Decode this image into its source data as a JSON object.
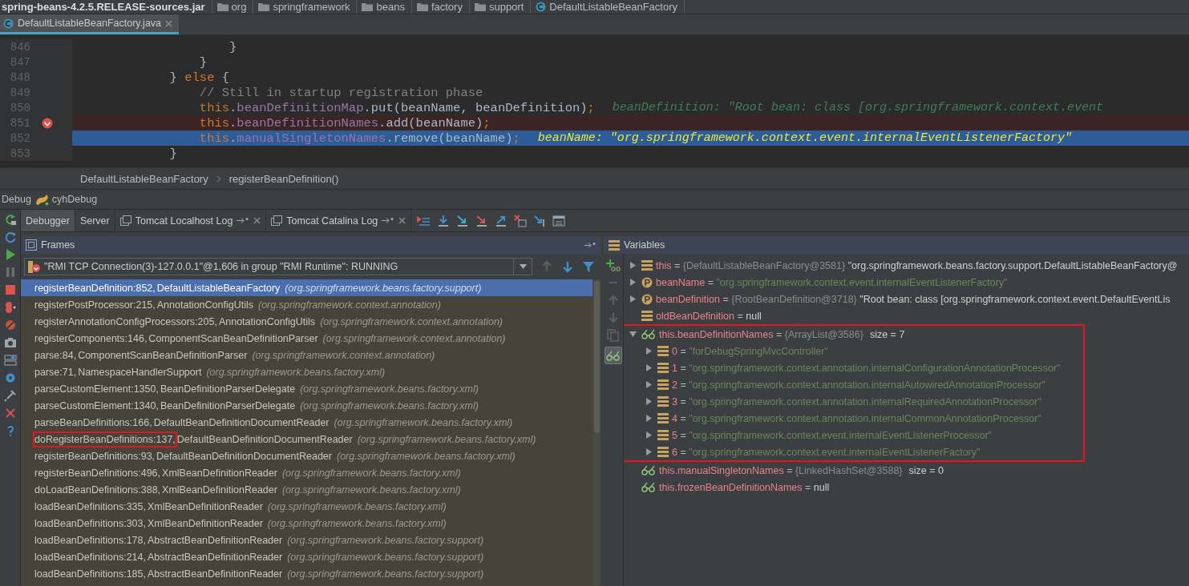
{
  "nav_bar": {
    "items": [
      {
        "label": "spring-beans-4.2.5.RELEASE-sources.jar",
        "kind": "jar"
      },
      {
        "label": "org",
        "kind": "folder"
      },
      {
        "label": "springframework",
        "kind": "folder"
      },
      {
        "label": "beans",
        "kind": "folder"
      },
      {
        "label": "factory",
        "kind": "folder"
      },
      {
        "label": "support",
        "kind": "folder"
      },
      {
        "label": "DefaultListableBeanFactory",
        "kind": "class"
      }
    ]
  },
  "editor_tabs": [
    {
      "label": "DefaultListableBeanFactory.java",
      "selected": true
    }
  ],
  "code_lines": [
    {
      "number": "846",
      "kind": "plain",
      "tokens": [
        {
          "kind": "plain",
          "text": "                    }"
        }
      ]
    },
    {
      "number": "847",
      "kind": "plain",
      "tokens": [
        {
          "kind": "plain",
          "text": "                }"
        }
      ]
    },
    {
      "number": "848",
      "kind": "plain",
      "tokens": [
        {
          "kind": "plain",
          "text": "            } "
        },
        {
          "kind": "keyword",
          "text": "else"
        },
        {
          "kind": "plain",
          "text": " {"
        }
      ]
    },
    {
      "number": "849",
      "kind": "plain",
      "tokens": [
        {
          "kind": "comment",
          "text": "                // Still in startup registration phase"
        }
      ]
    },
    {
      "number": "850",
      "kind": "plain",
      "tokens": [
        {
          "kind": "keyword",
          "text": "                this"
        },
        {
          "kind": "plain",
          "text": "."
        },
        {
          "kind": "field",
          "text": "beanDefinitionMap"
        },
        {
          "kind": "plain",
          "text": ".put(beanName, beanDefinition)"
        },
        {
          "kind": "keyword",
          "text": ";"
        },
        {
          "kind": "hint",
          "text": "beanDefinition: \"Root bean: class [org.springframework.context.event"
        }
      ]
    },
    {
      "number": "851",
      "kind": "breakpoint",
      "tokens": [
        {
          "kind": "keyword",
          "text": "                this"
        },
        {
          "kind": "plain",
          "text": "."
        },
        {
          "kind": "field",
          "text": "beanDefinitionNames"
        },
        {
          "kind": "plain",
          "text": ".add(beanName)"
        },
        {
          "kind": "keyword",
          "text": ";"
        }
      ]
    },
    {
      "number": "852",
      "kind": "execution",
      "tokens": [
        {
          "kind": "keyword",
          "text": "                this"
        },
        {
          "kind": "plain",
          "text": "."
        },
        {
          "kind": "field",
          "text": "manualSingletonNames"
        },
        {
          "kind": "plain",
          "text": ".remove(beanName)"
        },
        {
          "kind": "keyword",
          "text": ";"
        },
        {
          "kind": "hint",
          "text": "beanName: \"org.springframework.context.event.internalEventListenerFactory\""
        }
      ]
    },
    {
      "number": "853",
      "kind": "plain",
      "tokens": [
        {
          "kind": "plain",
          "text": "            }"
        }
      ]
    }
  ],
  "editor_breadcrumb": [
    "DefaultListableBeanFactory",
    "registerBeanDefinition()"
  ],
  "debug": {
    "title": "Debug",
    "session": "cyhDebug"
  },
  "debug_tabs": [
    {
      "label": "Debugger",
      "selected": true,
      "kind": "plain"
    },
    {
      "label": "Server",
      "selected": false,
      "kind": "plain"
    },
    {
      "label": "Tomcat Localhost Log",
      "selected": false,
      "kind": "log"
    },
    {
      "label": "Tomcat Catalina Log",
      "selected": false,
      "kind": "log"
    }
  ],
  "frames": {
    "title": "Frames",
    "thread": "\"RMI TCP Connection(3)-127.0.0.1\"@1,606 in group \"RMI Runtime\": RUNNING",
    "items": [
      {
        "method": "registerBeanDefinition:852,",
        "class": "DefaultListableBeanFactory",
        "package": "(org.springframework.beans.factory.support)",
        "selected": true,
        "annotated": false
      },
      {
        "method": "registerPostProcessor:215,",
        "class": "AnnotationConfigUtils",
        "package": "(org.springframework.context.annotation)",
        "selected": false,
        "annotated": false
      },
      {
        "method": "registerAnnotationConfigProcessors:205,",
        "class": "AnnotationConfigUtils",
        "package": "(org.springframework.context.annotation)",
        "selected": false,
        "annotated": false
      },
      {
        "method": "registerComponents:146,",
        "class": "ComponentScanBeanDefinitionParser",
        "package": "(org.springframework.context.annotation)",
        "selected": false,
        "annotated": false
      },
      {
        "method": "parse:84,",
        "class": "ComponentScanBeanDefinitionParser",
        "package": "(org.springframework.context.annotation)",
        "selected": false,
        "annotated": false
      },
      {
        "method": "parse:71,",
        "class": "NamespaceHandlerSupport",
        "package": "(org.springframework.beans.factory.xml)",
        "selected": false,
        "annotated": false
      },
      {
        "method": "parseCustomElement:1350,",
        "class": "BeanDefinitionParserDelegate",
        "package": "(org.springframework.beans.factory.xml)",
        "selected": false,
        "annotated": false
      },
      {
        "method": "parseCustomElement:1340,",
        "class": "BeanDefinitionParserDelegate",
        "package": "(org.springframework.beans.factory.xml)",
        "selected": false,
        "annotated": false
      },
      {
        "method": "parseBeanDefinitions:166,",
        "class": "DefaultBeanDefinitionDocumentReader",
        "package": "(org.springframework.beans.factory.xml)",
        "selected": false,
        "annotated": false
      },
      {
        "method": "doRegisterBeanDefinitions:137,",
        "class": "DefaultBeanDefinitionDocumentReader",
        "package": "(org.springframework.beans.factory.xml)",
        "selected": false,
        "annotated": true
      },
      {
        "method": "registerBeanDefinitions:93,",
        "class": "DefaultBeanDefinitionDocumentReader",
        "package": "(org.springframework.beans.factory.xml)",
        "selected": false,
        "annotated": false
      },
      {
        "method": "registerBeanDefinitions:496,",
        "class": "XmlBeanDefinitionReader",
        "package": "(org.springframework.beans.factory.xml)",
        "selected": false,
        "annotated": false
      },
      {
        "method": "doLoadBeanDefinitions:388,",
        "class": "XmlBeanDefinitionReader",
        "package": "(org.springframework.beans.factory.xml)",
        "selected": false,
        "annotated": false
      },
      {
        "method": "loadBeanDefinitions:335,",
        "class": "XmlBeanDefinitionReader",
        "package": "(org.springframework.beans.factory.xml)",
        "selected": false,
        "annotated": false
      },
      {
        "method": "loadBeanDefinitions:303,",
        "class": "XmlBeanDefinitionReader",
        "package": "(org.springframework.beans.factory.xml)",
        "selected": false,
        "annotated": false
      },
      {
        "method": "loadBeanDefinitions:178,",
        "class": "AbstractBeanDefinitionReader",
        "package": "(org.springframework.beans.factory.support)",
        "selected": false,
        "annotated": false
      },
      {
        "method": "loadBeanDefinitions:214,",
        "class": "AbstractBeanDefinitionReader",
        "package": "(org.springframework.beans.factory.support)",
        "selected": false,
        "annotated": false
      },
      {
        "method": "loadBeanDefinitions:185,",
        "class": "AbstractBeanDefinitionReader",
        "package": "(org.springframework.beans.factory.support)",
        "selected": false,
        "annotated": false
      }
    ]
  },
  "variables": {
    "title": "Variables",
    "items": [
      {
        "kind": "field",
        "name": "this",
        "equals": "=",
        "expandable": true,
        "expanded": false,
        "annotated": false,
        "type": "{DefaultListableBeanFactory@3581}",
        "value": "\"org.springframework.beans.factory.support.DefaultListableBeanFactory@"
      },
      {
        "kind": "param",
        "name": "beanName",
        "equals": "=",
        "expandable": true,
        "expanded": false,
        "annotated": false,
        "string": "\"org.springframework.context.event.internalEventListenerFactory\""
      },
      {
        "kind": "param",
        "name": "beanDefinition",
        "equals": "=",
        "expandable": true,
        "expanded": false,
        "annotated": false,
        "type": "{RootBeanDefinition@3718}",
        "value": "\"Root bean: class [org.springframework.context.event.DefaultEventLis"
      },
      {
        "kind": "field",
        "name": "oldBeanDefinition",
        "equals": "=",
        "expandable": false,
        "annotated": false,
        "value": "null"
      },
      {
        "kind": "watch",
        "name": "this.beanDefinitionNames",
        "equals": "=",
        "expandable": true,
        "expanded": true,
        "annotated": true,
        "type": "{ArrayList@3586}",
        "size": "size = 7",
        "children": [
          {
            "kind": "field",
            "name": "0",
            "equals": "=",
            "expandable": true,
            "expanded": false,
            "annotated": false,
            "string": "\"forDebugSpringMvcController\""
          },
          {
            "kind": "field",
            "name": "1",
            "equals": "=",
            "expandable": true,
            "expanded": false,
            "annotated": false,
            "string": "\"org.springframework.context.annotation.internalConfigurationAnnotationProcessor\""
          },
          {
            "kind": "field",
            "name": "2",
            "equals": "=",
            "expandable": true,
            "expanded": false,
            "annotated": false,
            "string": "\"org.springframework.context.annotation.internalAutowiredAnnotationProcessor\""
          },
          {
            "kind": "field",
            "name": "3",
            "equals": "=",
            "expandable": true,
            "expanded": false,
            "annotated": false,
            "string": "\"org.springframework.context.annotation.internalRequiredAnnotationProcessor\""
          },
          {
            "kind": "field",
            "name": "4",
            "equals": "=",
            "expandable": true,
            "expanded": false,
            "annotated": false,
            "string": "\"org.springframework.context.annotation.internalCommonAnnotationProcessor\""
          },
          {
            "kind": "field",
            "name": "5",
            "equals": "=",
            "expandable": true,
            "expanded": false,
            "annotated": false,
            "string": "\"org.springframework.context.event.internalEventListenerProcessor\""
          },
          {
            "kind": "field",
            "name": "6",
            "equals": "=",
            "expandable": true,
            "expanded": false,
            "annotated": false,
            "string": "\"org.springframework.context.event.internalEventListenerFactory\""
          }
        ]
      },
      {
        "kind": "watch",
        "name": "this.manualSingletonNames",
        "equals": "=",
        "expandable": false,
        "annotated": false,
        "type": "{LinkedHashSet@3588}",
        "size": "size = 0"
      },
      {
        "kind": "watch",
        "name": "this.frozenBeanDefinitionNames",
        "equals": "=",
        "expandable": false,
        "annotated": false,
        "value": "null"
      }
    ]
  }
}
